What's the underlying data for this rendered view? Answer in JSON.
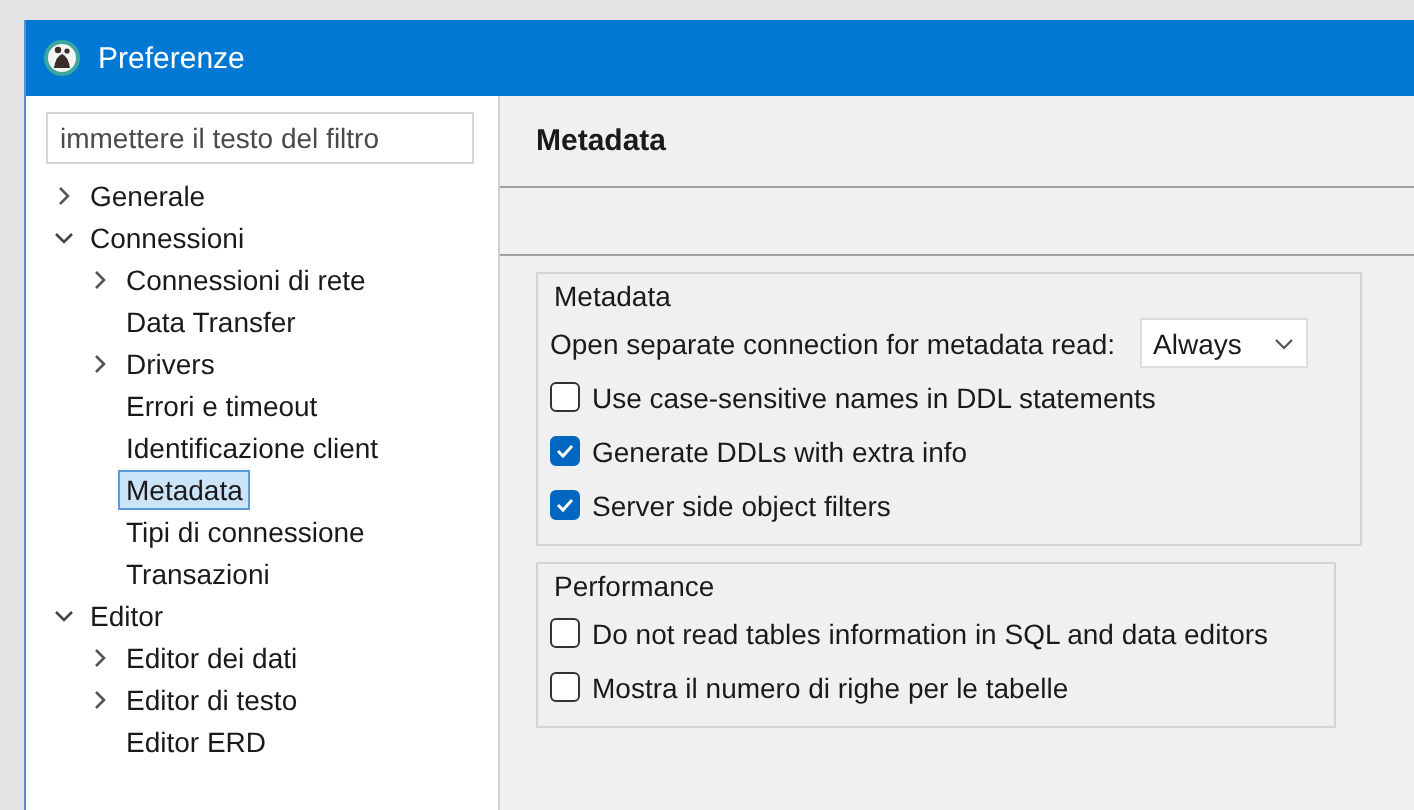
{
  "window": {
    "title": "Preferenze"
  },
  "filter": {
    "placeholder": "immettere il testo del filtro"
  },
  "tree": [
    {
      "label": "Generale",
      "expanded": false,
      "selected": false
    },
    {
      "label": "Connessioni",
      "expanded": true,
      "selected": false,
      "children": [
        {
          "label": "Connessioni di rete",
          "expanded": false,
          "selected": false
        },
        {
          "label": "Data Transfer",
          "selected": false
        },
        {
          "label": "Drivers",
          "expanded": false,
          "selected": false
        },
        {
          "label": "Errori e timeout",
          "selected": false
        },
        {
          "label": "Identificazione client",
          "selected": false
        },
        {
          "label": "Metadata",
          "selected": true
        },
        {
          "label": "Tipi di connessione",
          "selected": false
        },
        {
          "label": "Transazioni",
          "selected": false
        }
      ]
    },
    {
      "label": "Editor",
      "expanded": true,
      "selected": false,
      "children": [
        {
          "label": "Editor dei dati",
          "expanded": false,
          "selected": false
        },
        {
          "label": "Editor di testo",
          "expanded": false,
          "selected": false
        },
        {
          "label": "Editor ERD",
          "selected": false
        }
      ]
    }
  ],
  "page": {
    "title": "Metadata",
    "groups": [
      {
        "title": "Metadata",
        "items": [
          {
            "kind": "select",
            "label": "Open separate connection for metadata read:",
            "value": "Always"
          },
          {
            "kind": "checkbox",
            "label": "Use case-sensitive names in DDL statements",
            "checked": false
          },
          {
            "kind": "checkbox",
            "label": "Generate DDLs with extra info",
            "checked": true
          },
          {
            "kind": "checkbox",
            "label": "Server side object filters",
            "checked": true
          }
        ]
      },
      {
        "title": "Performance",
        "items": [
          {
            "kind": "checkbox",
            "label": "Do not read tables information in SQL and data editors",
            "checked": false
          },
          {
            "kind": "checkbox",
            "label": "Mostra il numero di righe per le tabelle",
            "checked": false
          }
        ]
      }
    ]
  }
}
